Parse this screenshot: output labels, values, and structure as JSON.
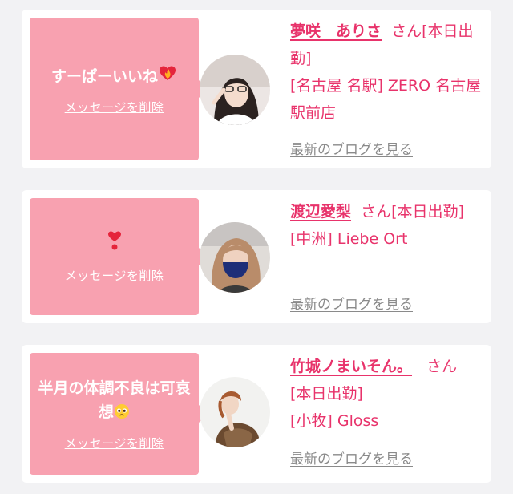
{
  "messages": [
    {
      "message_text": "すーぱーいいね",
      "message_icon": "heart-on-fire-icon",
      "delete_label": "メッセージを削除",
      "girl_name": "夢咲　ありさ",
      "name_suffix": "さん[本日出勤]",
      "shop": "[名古屋 名駅] ZERO 名古屋駅前店",
      "blog_link": "最新のブログを見る"
    },
    {
      "message_text": "",
      "message_icon": "heavy-heart-exclamation-icon",
      "delete_label": "メッセージを削除",
      "girl_name": "渡辺愛梨",
      "name_suffix": "さん[本日出勤]",
      "shop": "[中洲] Liebe Ort",
      "blog_link": "最新のブログを見る"
    },
    {
      "message_text": "半月の体調不良は可哀想",
      "message_icon": "pleading-face-icon",
      "delete_label": "メッセージを削除",
      "girl_name": "竹城ノまいそん。",
      "name_suffix": "さん",
      "status": "[本日出勤]",
      "shop": "[小牧] Gloss",
      "blog_link": "最新のブログを見る"
    }
  ],
  "colors": {
    "accent": "#e8336b",
    "bubble": "#f8a1b0",
    "link_gray": "#8a8a8a",
    "background": "#f2f2f4"
  }
}
